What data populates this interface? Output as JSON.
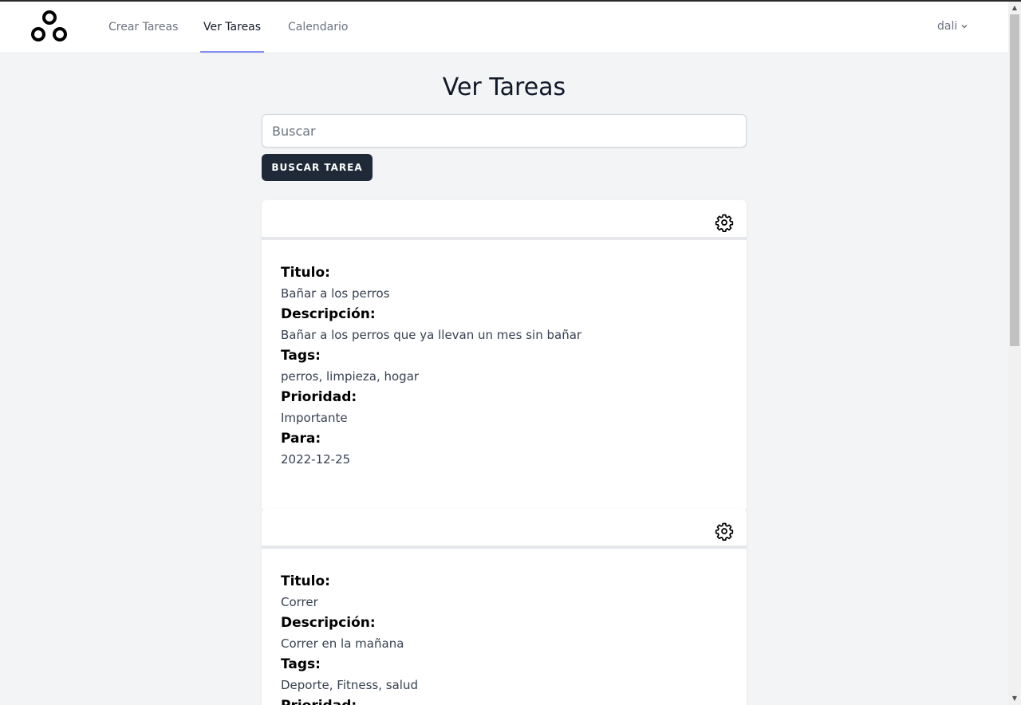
{
  "nav": {
    "links": [
      "Crear Tareas",
      "Ver Tareas",
      "Calendario"
    ],
    "active": "Ver Tareas",
    "user": "dali"
  },
  "page": {
    "title": "Ver Tareas",
    "search_placeholder": "Buscar",
    "search_button": "BUSCAR TAREA"
  },
  "labels": {
    "titulo": "Titulo:",
    "descripcion": "Descripción:",
    "tags": "Tags:",
    "prioridad": "Prioridad:",
    "para": "Para:"
  },
  "tasks": [
    {
      "titulo": "Bañar a los perros",
      "descripcion": "Bañar a los perros que ya llevan un mes sin bañar",
      "tags": "perros, limpieza, hogar",
      "prioridad": "Importante",
      "para": "2022-12-25"
    },
    {
      "titulo": "Correr",
      "descripcion": "Correr en la mañana",
      "tags": "Deporte, Fitness, salud"
    }
  ],
  "icons": {
    "logo": "logo-icon",
    "settings": "gear-icon",
    "dropdown": "chevron-down-icon"
  },
  "colors": {
    "active_underline": "#818cf8",
    "button": "#1f2937",
    "background": "#f3f4f6"
  }
}
